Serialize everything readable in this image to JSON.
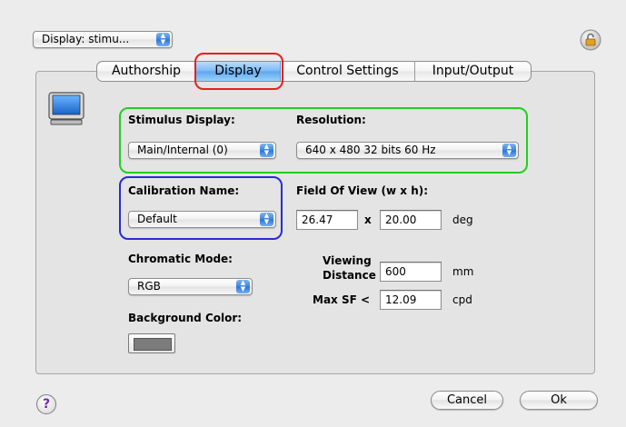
{
  "header": {
    "display_select": "Display: stimu...",
    "lock_icon": "lock-icon"
  },
  "tabs": [
    {
      "label": "Authorship"
    },
    {
      "label": "Display"
    },
    {
      "label": "Control Settings"
    },
    {
      "label": "Input/Output"
    }
  ],
  "active_tab": "Display",
  "display_panel": {
    "monitor_icon": "monitor-icon",
    "stimulus_display": {
      "label": "Stimulus Display:",
      "value": "Main/Internal (0)"
    },
    "resolution": {
      "label": "Resolution:",
      "value": "640 x 480  32 bits  60 Hz"
    },
    "calibration": {
      "label": "Calibration Name:",
      "value": "Default"
    },
    "field_of_view": {
      "label": "Field Of View (w x h):",
      "width": "26.47",
      "separator": "x",
      "height": "20.00",
      "unit": "deg"
    },
    "chromatic_mode": {
      "label": "Chromatic Mode:",
      "value": "RGB"
    },
    "viewing_distance": {
      "label_line1": "Viewing",
      "label_line2": "Distance",
      "value": "600",
      "unit": "mm"
    },
    "max_sf": {
      "label": "Max SF <",
      "value": "12.09",
      "unit": "cpd"
    },
    "background_color": {
      "label": "Background Color:",
      "swatch": "#7c7c7c"
    }
  },
  "highlights": {
    "tab": "#e8201e",
    "stimulus_group": "#20d020",
    "calibration_group": "#2a2ad8"
  },
  "footer": {
    "help": "?",
    "cancel": "Cancel",
    "ok": "Ok"
  }
}
